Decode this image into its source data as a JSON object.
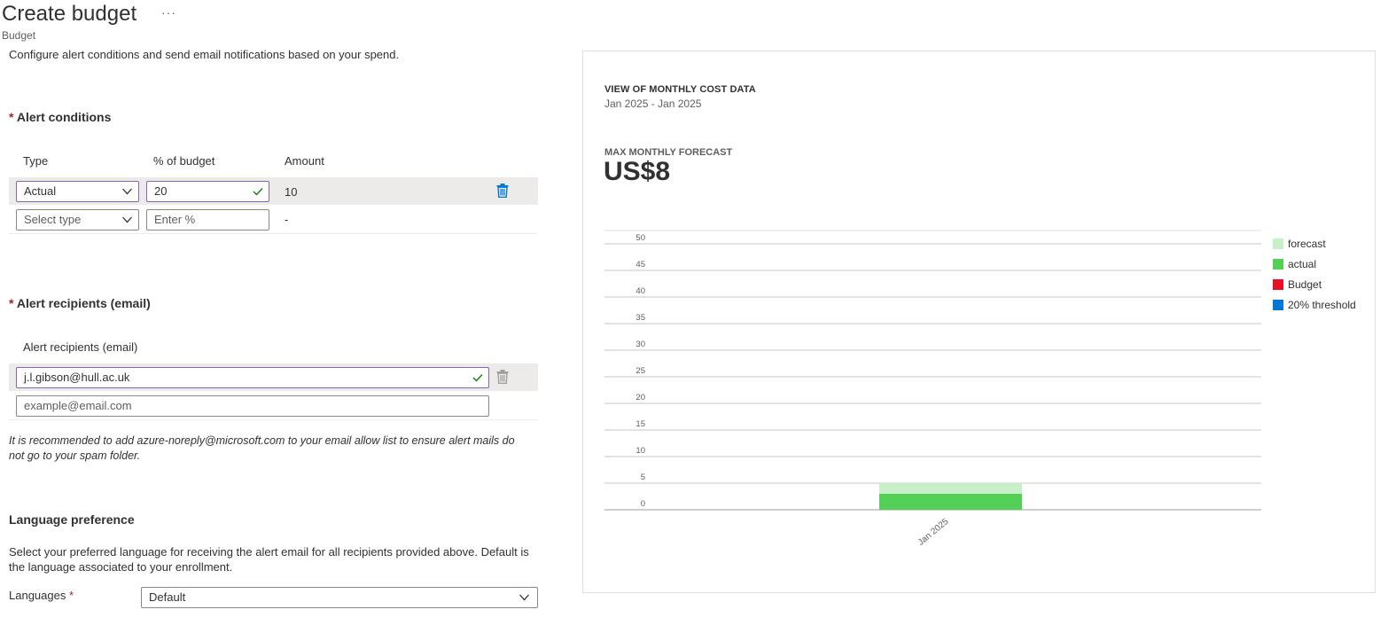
{
  "header": {
    "title": "Create budget",
    "more": "···",
    "subtitle": "Budget",
    "intro": "Configure alert conditions and send email notifications based on your spend."
  },
  "alert_conditions": {
    "required": "*",
    "title": "Alert conditions",
    "columns": {
      "type": "Type",
      "percent": "% of budget",
      "amount": "Amount"
    },
    "rows": [
      {
        "type": "Actual",
        "percent": "20",
        "amount": "10"
      },
      {
        "type_placeholder": "Select type",
        "percent_placeholder": "Enter %",
        "amount": "-"
      }
    ]
  },
  "alert_recipients": {
    "required": "*",
    "title": "Alert recipients (email)",
    "column": "Alert recipients (email)",
    "rows": [
      {
        "email": "j.l.gibson@hull.ac.uk"
      },
      {
        "placeholder": "example@email.com"
      }
    ],
    "hint": "It is recommended to add azure-noreply@microsoft.com to your email allow list to ensure alert mails do not go to your spam folder."
  },
  "language": {
    "title": "Language preference",
    "description": "Select your preferred language for receiving the alert email for all recipients provided above. Default is the language associated to your enrollment.",
    "label": "Languages",
    "required": "*",
    "value": "Default"
  },
  "chart_panel": {
    "heading": "VIEW OF MONTHLY COST DATA",
    "range": "Jan 2025 - Jan 2025",
    "forecast_label": "MAX MONTHLY FORECAST",
    "forecast_value": "US$8"
  },
  "chart_data": {
    "type": "bar",
    "categories": [
      "Jan 2025"
    ],
    "series": [
      {
        "name": "actual",
        "values": [
          3
        ],
        "color": "#54d058"
      },
      {
        "name": "forecast",
        "values": [
          2
        ],
        "color": "#c7f0c9"
      }
    ],
    "legend": [
      {
        "name": "forecast",
        "color": "#c7f0c9"
      },
      {
        "name": "actual",
        "color": "#54d058"
      },
      {
        "name": "Budget",
        "color": "#e81123"
      },
      {
        "name": "20% threshold",
        "color": "#0078d4"
      }
    ],
    "ylim": [
      0,
      50
    ],
    "yticks": [
      "0",
      "5",
      "10",
      "15",
      "20",
      "25",
      "30",
      "35",
      "40",
      "45",
      "50"
    ],
    "stacked": true,
    "grid": true,
    "legend_position": "right"
  },
  "colors": {
    "accent": "#0078d4",
    "focus_border": "#8764b8",
    "valid_check": "#107c10",
    "required": "#a4262c"
  }
}
